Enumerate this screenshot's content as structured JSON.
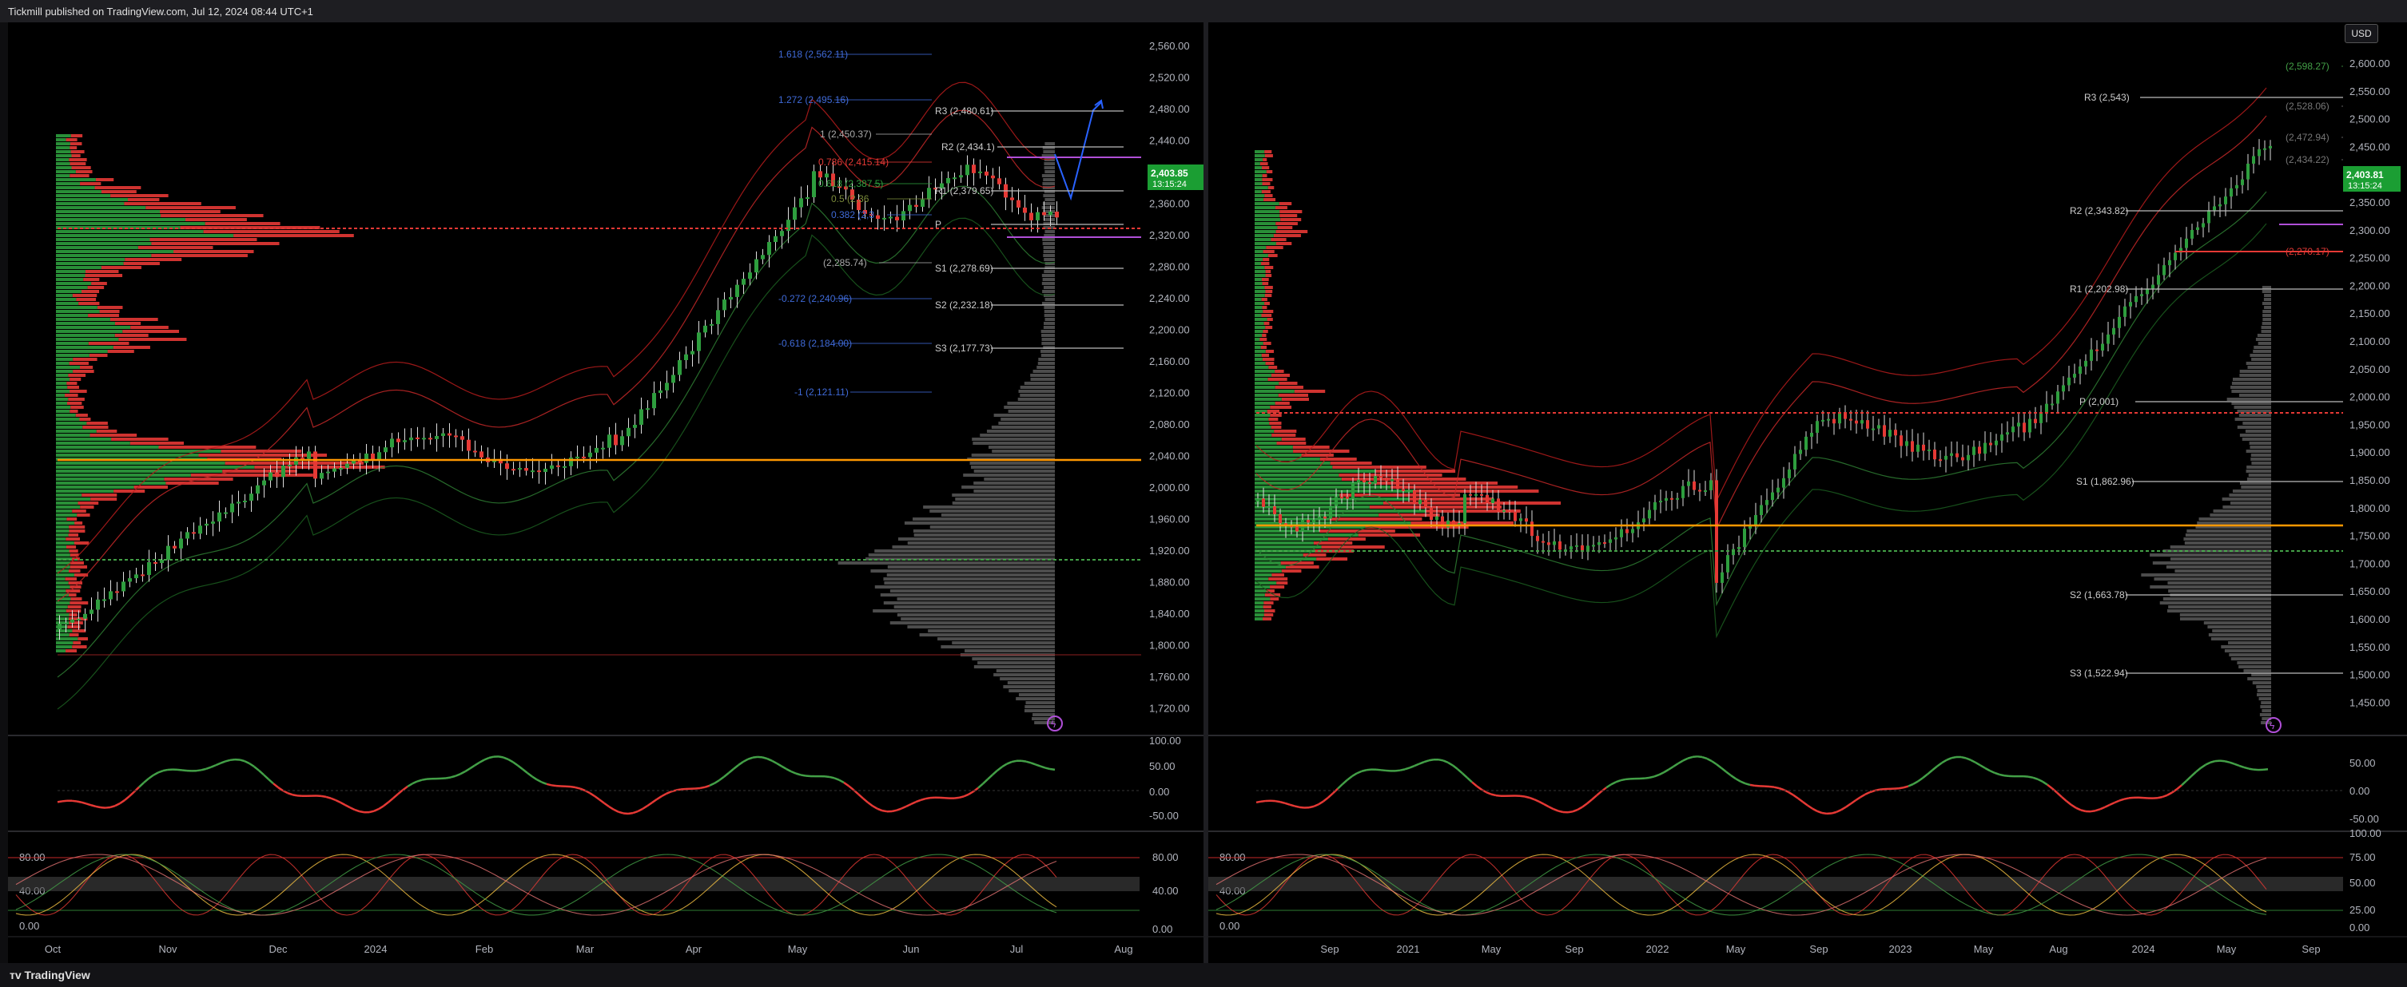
{
  "header": {
    "publisher_line": "Tickmill published on TradingView.com, Jul 12, 2024 08:44 UTC+1"
  },
  "footer": {
    "brand": "TradingView"
  },
  "currency_button": "USD",
  "colors": {
    "bull": "#26a69a",
    "green_bar": "#2e9e3e",
    "bear": "#e53935",
    "poc": "#ff9800",
    "bg": "#000000",
    "axis_text": "#b2b5be"
  },
  "left_chart": {
    "price_axis": [
      "2,560.00",
      "2,520.00",
      "2,480.00",
      "2,440.00",
      "2,400.00",
      "2,360.00",
      "2,320.00",
      "2,280.00",
      "2,240.00",
      "2,200.00",
      "2,160.00",
      "2,120.00",
      "2,080.00",
      "2,040.00",
      "2,000.00",
      "1,960.00",
      "1,920.00",
      "1,880.00",
      "1,840.00",
      "1,800.00",
      "1,760.00",
      "1,720.00"
    ],
    "time_axis": [
      "Oct",
      "Nov",
      "Dec",
      "2024",
      "Feb",
      "Mar",
      "Apr",
      "May",
      "Jun",
      "Jul",
      "Aug"
    ],
    "last_price": "2,403.85",
    "countdown": "13:15:24",
    "pivots": [
      "R3 (2,480.61)",
      "R2 (2,434.1)",
      "R1 (2,379.65)",
      "P",
      "S1 (2,278.69)",
      "S2 (2,232.18)",
      "S3 (2,177.73)"
    ],
    "fib_levels": [
      "1.618 (2,562.11)",
      "1.272 (2,495.16)",
      "1 (2,450.37)",
      "0.786 (2,415.14)",
      "0.618 (2,387.5)",
      "0.5 (2,36",
      "0.382 (2,3",
      "(2,285.74)",
      "-0.272 (2,240.96)",
      "-0.618 (2,184.00)",
      "-1 (2,121.11)"
    ],
    "rsi_axis": [
      "100.00",
      "50.00",
      "0.00",
      "-50.00"
    ],
    "stoch_axis": [
      "80.00",
      "40.00",
      "0.00"
    ]
  },
  "right_chart": {
    "price_axis": [
      "2,600.00",
      "2,550.00",
      "2,500.00",
      "2,450.00",
      "2,400.00",
      "2,350.00",
      "2,300.00",
      "2,250.00",
      "2,200.00",
      "2,150.00",
      "2,100.00",
      "2,050.00",
      "2,000.00",
      "1,950.00",
      "1,900.00",
      "1,850.00",
      "1,800.00",
      "1,750.00",
      "1,700.00",
      "1,650.00",
      "1,600.00",
      "1,550.00",
      "1,500.00",
      "1,450.00"
    ],
    "time_axis": [
      "Sep",
      "2021",
      "May",
      "Sep",
      "2022",
      "May",
      "Sep",
      "2023",
      "May",
      "Aug",
      "2024",
      "May",
      "Sep"
    ],
    "last_price": "2,403.81",
    "countdown": "13:15:24",
    "pivots": [
      "R3 (2,543)",
      "R2 (2,343.82)",
      "R1 (2,202.98)",
      "P (2,001)",
      "S1 (1,862.96)",
      "S2 (1,663.78)",
      "S3 (1,522.94)"
    ],
    "fib_levels": [
      "(2,598.27)",
      "(2,528.06)",
      "(2,472.94)",
      "(2,434.22)",
      "(2,270.17)"
    ],
    "rsi_axis": [
      "50.00",
      "0.00",
      "-50.00"
    ],
    "stoch_axis": [
      "100.00",
      "75.00",
      "50.00",
      "25.00",
      "0.00",
      "80.00",
      "40.00",
      "0.00"
    ]
  }
}
